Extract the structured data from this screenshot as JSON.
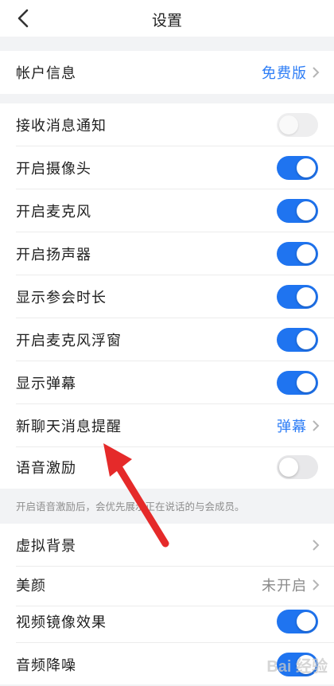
{
  "header": {
    "title": "设置"
  },
  "account": {
    "label": "帐户信息",
    "value": "免费版"
  },
  "settings": [
    {
      "label": "接收消息通知",
      "toggle": "off"
    },
    {
      "label": "开启摄像头",
      "toggle": "on"
    },
    {
      "label": "开启麦克风",
      "toggle": "on"
    },
    {
      "label": "开启扬声器",
      "toggle": "on"
    },
    {
      "label": "显示参会时长",
      "toggle": "on"
    },
    {
      "label": "开启麦克风浮窗",
      "toggle": "on"
    },
    {
      "label": "显示弹幕",
      "toggle": "on"
    },
    {
      "label": "新聊天消息提醒",
      "value": "弹幕"
    },
    {
      "label": "语音激励",
      "toggle": "off"
    }
  ],
  "hint": "开启语音激励后，会优先展示正在说话的与会成员。",
  "more": [
    {
      "label": "虚拟背景"
    },
    {
      "label": "美颜",
      "value": "未开启"
    },
    {
      "label": "视频镜像效果",
      "toggle": "on"
    },
    {
      "label": "音频降噪",
      "toggle": "on"
    }
  ],
  "watermark": "Bai 经验",
  "colors": {
    "accent": "#1f74f0",
    "link": "#2d7df6",
    "arrow": "#e52a2a"
  }
}
